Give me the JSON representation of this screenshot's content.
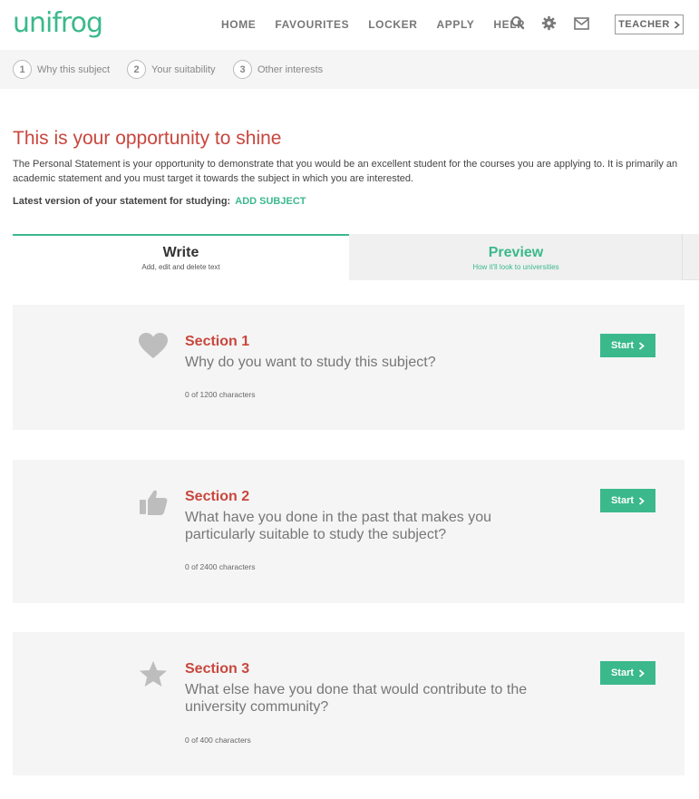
{
  "header": {
    "logo": "unifrog",
    "nav": [
      {
        "label": "HOME"
      },
      {
        "label": "FAVOURITES"
      },
      {
        "label": "LOCKER"
      },
      {
        "label": "APPLY"
      },
      {
        "label": "HELP"
      }
    ],
    "icons": [
      "search-icon",
      "gear-icon",
      "mail-icon"
    ],
    "teacher_label": "TEACHER"
  },
  "steps": [
    {
      "num": "1",
      "label": "Why this subject"
    },
    {
      "num": "2",
      "label": "Your suitability"
    },
    {
      "num": "3",
      "label": "Other interests"
    }
  ],
  "intro": {
    "title": "This is your opportunity to shine",
    "body": "The Personal Statement is your opportunity to demonstrate that you would be an excellent student for the courses you are applying to. It is primarily an academic statement and you must target it towards the subject in which you are interested.",
    "latest_label": "Latest version of your statement for studying:",
    "add_subject": "ADD SUBJECT"
  },
  "tabs": {
    "write": {
      "title": "Write",
      "subtitle": "Add, edit and delete text"
    },
    "preview": {
      "title": "Preview",
      "subtitle": "How it'll look to universities"
    }
  },
  "sections": [
    {
      "icon": "heart-icon",
      "title": "Section 1",
      "question": "Why do you want to study this subject?",
      "count": "0 of 1200 characters",
      "button": "Start"
    },
    {
      "icon": "thumbs-up-icon",
      "title": "Section 2",
      "question": "What have you done in the past that makes you particularly suitable to study the subject?",
      "count": "0 of 2400 characters",
      "button": "Start"
    },
    {
      "icon": "star-icon",
      "title": "Section 3",
      "question": "What else have you done that would contribute to the university community?",
      "count": "0 of 400 characters",
      "button": "Start"
    }
  ],
  "colors": {
    "brand_green": "#3bb98c",
    "accent_red": "#c9463d",
    "panel_grey": "#f5f5f5"
  }
}
